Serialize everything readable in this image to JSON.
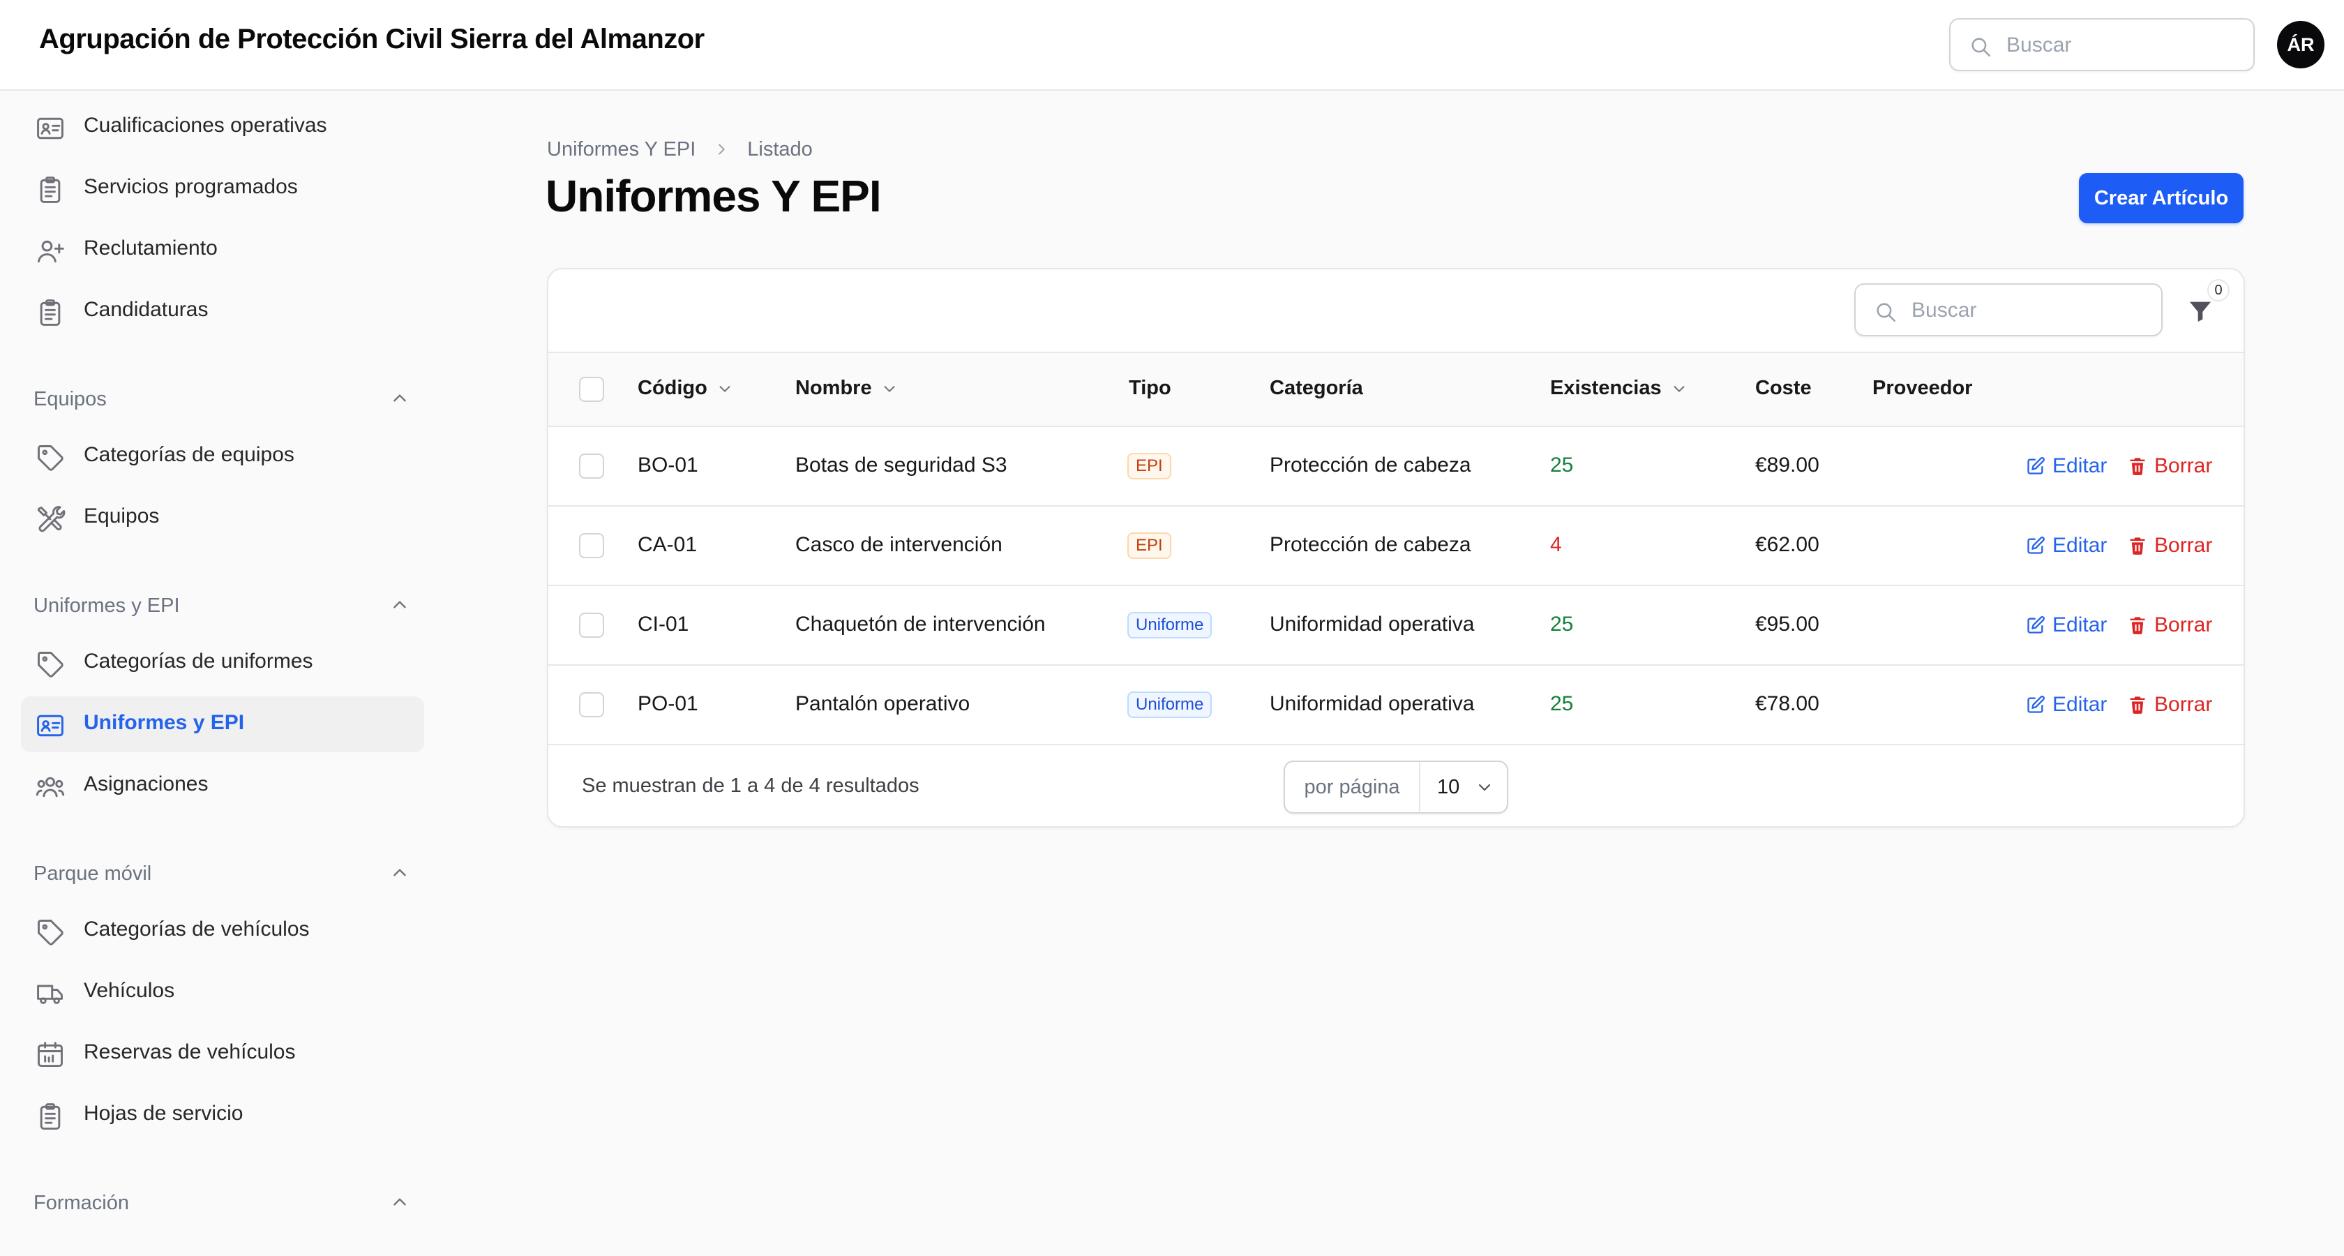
{
  "app": {
    "title": "Agrupación de Protección Civil Sierra del Almanzor",
    "search_placeholder": "Buscar",
    "avatar_initials": "ÁR"
  },
  "sidebar": {
    "top_items": [
      {
        "label": "Cualificaciones operativas",
        "icon": "id-card-icon"
      },
      {
        "label": "Servicios programados",
        "icon": "clipboard-icon"
      },
      {
        "label": "Reclutamiento",
        "icon": "user-plus-icon"
      },
      {
        "label": "Candidaturas",
        "icon": "clipboard-icon"
      }
    ],
    "groups": [
      {
        "label": "Equipos",
        "items": [
          {
            "label": "Categorías de equipos",
            "icon": "tag-icon"
          },
          {
            "label": "Equipos",
            "icon": "wrench-screwdriver-icon"
          }
        ]
      },
      {
        "label": "Uniformes y EPI",
        "items": [
          {
            "label": "Categorías de uniformes",
            "icon": "tag-icon"
          },
          {
            "label": "Uniformes y EPI",
            "icon": "id-card-icon",
            "active": true
          },
          {
            "label": "Asignaciones",
            "icon": "user-group-icon"
          }
        ]
      },
      {
        "label": "Parque móvil",
        "items": [
          {
            "label": "Categorías de vehículos",
            "icon": "tag-icon"
          },
          {
            "label": "Vehículos",
            "icon": "truck-icon"
          },
          {
            "label": "Reservas de vehículos",
            "icon": "calendar-icon"
          },
          {
            "label": "Hojas de servicio",
            "icon": "clipboard-icon"
          }
        ]
      },
      {
        "label": "Formación",
        "items": []
      }
    ]
  },
  "breadcrumb": [
    "Uniformes Y EPI",
    "Listado"
  ],
  "page": {
    "title": "Uniformes Y EPI",
    "create_label": "Crear Artículo"
  },
  "table": {
    "search_placeholder": "Buscar",
    "filter_count": "0",
    "columns": {
      "codigo": "Código",
      "nombre": "Nombre",
      "tipo": "Tipo",
      "categoria": "Categoría",
      "existencias": "Existencias",
      "coste": "Coste",
      "proveedor": "Proveedor"
    },
    "rows": [
      {
        "codigo": "BO-01",
        "nombre": "Botas de seguridad S3",
        "tipo": "EPI",
        "categoria": "Protección de cabeza",
        "existencias": "25",
        "coste": "€89.00",
        "proveedor": ""
      },
      {
        "codigo": "CA-01",
        "nombre": "Casco de intervención",
        "tipo": "EPI",
        "categoria": "Protección de cabeza",
        "existencias": "4",
        "coste": "€62.00",
        "proveedor": ""
      },
      {
        "codigo": "CI-01",
        "nombre": "Chaquetón de intervención",
        "tipo": "Uniforme",
        "categoria": "Uniformidad operativa",
        "existencias": "25",
        "coste": "€95.00",
        "proveedor": ""
      },
      {
        "codigo": "PO-01",
        "nombre": "Pantalón operativo",
        "tipo": "Uniforme",
        "categoria": "Uniformidad operativa",
        "existencias": "25",
        "coste": "€78.00",
        "proveedor": ""
      }
    ],
    "actions": {
      "edit": "Editar",
      "delete": "Borrar"
    },
    "footer": {
      "summary": "Se muestran de 1 a 4 de 4 resultados",
      "per_page_label": "por página",
      "per_page_value": "10"
    }
  },
  "colors": {
    "accent": "#1d5cf5",
    "stock_ok": "#15803d",
    "stock_low": "#dc2626",
    "danger": "#dc2626"
  }
}
